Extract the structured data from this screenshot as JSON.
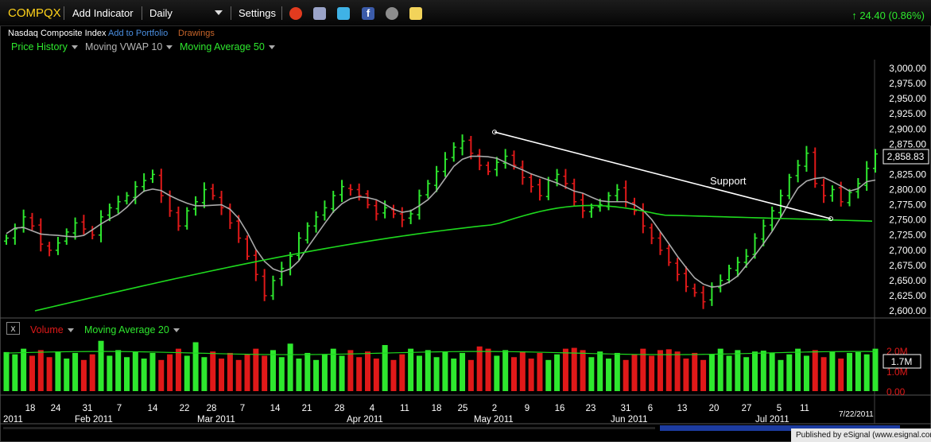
{
  "toolbar": {
    "symbol": "COMPQX",
    "add_indicator": "Add Indicator",
    "interval": "Daily",
    "settings": "Settings",
    "change": "↑ 24.40 (0.86%)"
  },
  "subheader": {
    "name": "Nasdaq Composite Index",
    "add_portfolio": "Add to Portfolio",
    "drawings": "Drawings"
  },
  "studies": {
    "price_history": "Price History",
    "vwap": "Moving VWAP 10",
    "ma50": "Moving Average 50"
  },
  "volume_studies": {
    "volume": "Volume",
    "ma20": "Moving Average 20"
  },
  "icons": [
    "alarm-clock-icon",
    "print-icon",
    "twitter-icon",
    "facebook-icon",
    "camera-icon",
    "sticky-note-icon"
  ],
  "colors": {
    "up": "#2ee82e",
    "down": "#e01919",
    "ma50": "#1ed91e",
    "vwap": "#a9a9a9",
    "symbol": "#ffd21a"
  },
  "chart_data": {
    "type": "bar",
    "title": "COMPQX",
    "ylim": [
      2600,
      3000
    ],
    "y_ticks": [
      "3,000.00",
      "2,975.00",
      "2,950.00",
      "2,925.00",
      "2,900.00",
      "2,875.00",
      "2,850.00",
      "2,825.00",
      "2,800.00",
      "2,775.00",
      "2,750.00",
      "2,725.00",
      "2,700.00",
      "2,675.00",
      "2,650.00",
      "2,625.00",
      "2,600.00"
    ],
    "last_price": "2,858.83",
    "x_day_labels": [
      "18",
      "24",
      "31",
      "7",
      "14",
      "22",
      "28",
      "7",
      "14",
      "21",
      "28",
      "4",
      "11",
      "18",
      "25",
      "2",
      "9",
      "16",
      "23",
      "31",
      "6",
      "13",
      "20",
      "27",
      "5",
      "11"
    ],
    "x_month_labels": [
      "2011",
      "Feb 2011",
      "Mar 2011",
      "Apr 2011",
      "May 2011",
      "Jun 2011",
      "Jul 2011"
    ],
    "date_stamp": "7/22/2011",
    "annotation": "Support",
    "support_line": {
      "from": [
        "May 2",
        2895
      ],
      "to": [
        "Jul 19",
        2752
      ]
    },
    "close_path": [
      2720,
      2735,
      2755,
      2740,
      2710,
      2700,
      2712,
      2730,
      2745,
      2735,
      2725,
      2755,
      2770,
      2780,
      2790,
      2805,
      2815,
      2825,
      2790,
      2765,
      2740,
      2765,
      2780,
      2800,
      2790,
      2770,
      2745,
      2720,
      2690,
      2660,
      2625,
      2650,
      2670,
      2690,
      2720,
      2740,
      2755,
      2770,
      2790,
      2805,
      2800,
      2790,
      2775,
      2760,
      2770,
      2760,
      2750,
      2760,
      2790,
      2810,
      2830,
      2850,
      2870,
      2880,
      2860,
      2840,
      2830,
      2845,
      2855,
      2840,
      2820,
      2805,
      2790,
      2815,
      2825,
      2810,
      2780,
      2765,
      2770,
      2775,
      2790,
      2800,
      2780,
      2765,
      2740,
      2720,
      2700,
      2680,
      2660,
      2640,
      2630,
      2615,
      2640,
      2650,
      2670,
      2680,
      2690,
      2720,
      2740,
      2765,
      2790,
      2820,
      2840,
      2860,
      2810,
      2790,
      2800,
      2780,
      2795,
      2810,
      2835,
      2858.83
    ],
    "ma50_range": [
      2600,
      2758
    ],
    "volume": {
      "ylim": [
        0,
        2.5
      ],
      "y_ticks": [
        "2.0M",
        "1.0M",
        "0.00"
      ],
      "last": "1.7M"
    }
  },
  "footer": "Published by eSignal (www.esignal.com)"
}
